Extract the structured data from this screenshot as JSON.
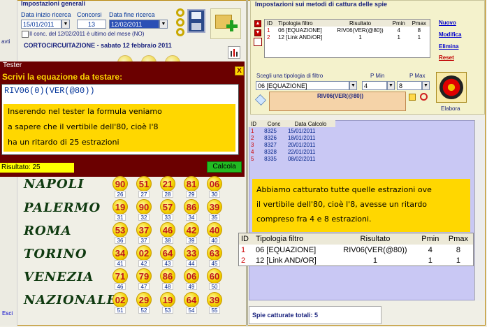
{
  "left_panel": {
    "title": "Impostazioni generali",
    "data_inizio_label": "Data inizio ricerca",
    "data_inizio_value": "15/01/2011",
    "concorsi_label": "Concorsi",
    "concorsi_value": "13",
    "data_fine_label": "Data fine ricerca",
    "data_fine_value": "12/02/2011",
    "ultimo_check_label": "Il conc. del 12/02/2011 è ultimo del mese (NO)",
    "cortocircuitazione": "CORTOCIRCUITAZIONE - sabato 12 febbraio 2011"
  },
  "sidebar": {
    "top_fragment": "avti",
    "bottom_link": "Esci"
  },
  "tester": {
    "title": "Tester",
    "close": "X",
    "prompt": "Scrivi la equazione da testare:",
    "formula": "RIV06(0)(VER(@80))",
    "note_lines": [
      "Inserendo nel tester la formula veniamo",
      "a sapere che il vertibile dell'80, cioè l'8",
      "ha un ritardo di 25 estrazioni"
    ],
    "result_label": "Risultato: 25",
    "calc_button": "Calcola"
  },
  "wheels": [
    {
      "name": "NAPOLI",
      "balls": [
        "90",
        "51",
        "21",
        "81",
        "06"
      ],
      "small": [
        "26",
        "27",
        "28",
        "29",
        "30"
      ]
    },
    {
      "name": "PALERMO",
      "balls": [
        "19",
        "90",
        "57",
        "86",
        "39"
      ],
      "small": [
        "31",
        "32",
        "33",
        "34",
        "35"
      ]
    },
    {
      "name": "ROMA",
      "balls": [
        "53",
        "37",
        "46",
        "42",
        "40"
      ],
      "small": [
        "36",
        "37",
        "38",
        "39",
        "40"
      ]
    },
    {
      "name": "TORINO",
      "balls": [
        "34",
        "02",
        "64",
        "33",
        "63"
      ],
      "small": [
        "41",
        "42",
        "43",
        "44",
        "45"
      ]
    },
    {
      "name": "VENEZIA",
      "balls": [
        "71",
        "79",
        "86",
        "06",
        "60"
      ],
      "small": [
        "46",
        "47",
        "48",
        "49",
        "50"
      ]
    },
    {
      "name": "NAZIONALE",
      "balls": [
        "02",
        "29",
        "19",
        "64",
        "39"
      ],
      "small": [
        "51",
        "52",
        "53",
        "54",
        "55"
      ]
    }
  ],
  "right_panel": {
    "title": "Impostazioni sui metodi di cattura delle spie",
    "columns": [
      "ID",
      "Tipologia filtro",
      "Risultato",
      "Pmin",
      "Pmax"
    ],
    "rows": [
      {
        "id": "1",
        "tipologia": "06 [EQUAZIONE]",
        "risultato": "RIV06(VER(@80))",
        "pmin": "4",
        "pmax": "8"
      },
      {
        "id": "2",
        "tipologia": "12 [Link AND/OR]",
        "risultato": "1",
        "pmin": "1",
        "pmax": "1"
      }
    ],
    "links": [
      "Nuovo",
      "Modifica",
      "Elimina",
      "Reset"
    ],
    "scegli_label": "Scegli una tipologia di filtro",
    "pmin_label": "P Min",
    "pmax_label": "P Max",
    "tipologia_value": "06 [EQUAZIONE]",
    "pmin_value": "4",
    "pmax_value": "8",
    "formula_value": "RIV06(VER(@80))",
    "elabora_label": "Elabora"
  },
  "results": {
    "columns": [
      "ID",
      "Conc",
      "Data Calcolo"
    ],
    "rows": [
      {
        "id": "1",
        "conc": "8325",
        "data": "15/01/2011"
      },
      {
        "id": "2",
        "conc": "8326",
        "data": "18/01/2011"
      },
      {
        "id": "3",
        "conc": "8327",
        "data": "20/01/2011"
      },
      {
        "id": "4",
        "conc": "8328",
        "data": "22/01/2011"
      },
      {
        "id": "5",
        "conc": "8335",
        "data": "08/02/2011"
      }
    ],
    "spie_catturate": "Spie catturate totali: 5"
  },
  "annotation": {
    "lines": [
      "Abbiamo catturato tutte quelle estrazioni ove",
      "il vertibile dell'80, cioè l'8, avesse un ritardo",
      "compreso fra 4 e 8 estrazioni."
    ],
    "columns": [
      "ID",
      "Tipologia filtro",
      "Risultato",
      "Pmin",
      "Pmax"
    ],
    "rows": [
      {
        "id": "1",
        "tipologia": "06 [EQUAZIONE]",
        "risultato": "RIV06(VER(@80))",
        "pmin": "4",
        "pmax": "8"
      },
      {
        "id": "2",
        "tipologia": "12 [Link AND/OR]",
        "risultato": "1",
        "pmin": "1",
        "pmax": "1"
      }
    ]
  },
  "colors": {
    "tester_title_bar": "#6b0000",
    "note_yellow": "#ffd700",
    "ball_number": "#c0161b",
    "calc_button": "#22bb22",
    "results_bg": "#c9c8f4"
  }
}
